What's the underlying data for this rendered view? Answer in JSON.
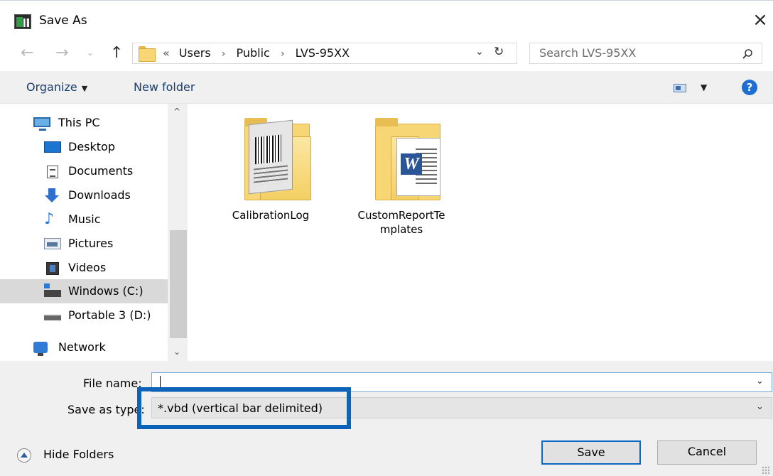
{
  "window": {
    "title": "Save As",
    "close_glyph": "×"
  },
  "nav": {
    "back_glyph": "←",
    "forward_glyph": "→",
    "history_glyph": "⌄",
    "up_glyph": "↑"
  },
  "address": {
    "crumbs": [
      "«",
      "Users",
      "Public",
      "LVS-95XX"
    ],
    "separator": "›",
    "dropdown_glyph": "⌄",
    "refresh_glyph": "↻"
  },
  "search": {
    "placeholder": "Search LVS-95XX"
  },
  "toolbar": {
    "organize_label": "Organize",
    "organize_caret": "▼",
    "new_folder_label": "New folder",
    "view_caret": "▼",
    "help_glyph": "?"
  },
  "navpane": {
    "scroll_up": "^",
    "scroll_down": "⌄",
    "items": [
      {
        "label": "This PC",
        "icon": "computer-icon"
      },
      {
        "label": "Desktop",
        "icon": "desktop-icon"
      },
      {
        "label": "Documents",
        "icon": "documents-icon"
      },
      {
        "label": "Downloads",
        "icon": "downloads-icon"
      },
      {
        "label": "Music",
        "icon": "music-icon"
      },
      {
        "label": "Pictures",
        "icon": "pictures-icon"
      },
      {
        "label": "Videos",
        "icon": "videos-icon"
      },
      {
        "label": "Windows (C:)",
        "icon": "windows-drive-icon",
        "selected": true
      },
      {
        "label": "Portable 3 (D:)",
        "icon": "drive-icon"
      },
      {
        "label": "Network",
        "icon": "network-icon"
      }
    ]
  },
  "files": [
    {
      "name": "CalibrationLog",
      "icon": "folder-barcode-icon"
    },
    {
      "name_line1": "CustomReportTe",
      "name_line2": "mplates",
      "icon": "folder-word-icon"
    }
  ],
  "form": {
    "file_name_label": "File name:",
    "file_name_value": "",
    "save_as_type_label": "Save as type:",
    "save_as_type_value": "*.vbd (vertical bar delimited)",
    "caret_glyph": "⌄"
  },
  "footer": {
    "hide_folders_label": "Hide Folders",
    "save_label": "Save",
    "cancel_label": "Cancel"
  },
  "colors": {
    "accent": "#0d63b8",
    "folder": "#f6d675",
    "selected_row": "#d9d9d9",
    "help": "#1f6fd1"
  }
}
